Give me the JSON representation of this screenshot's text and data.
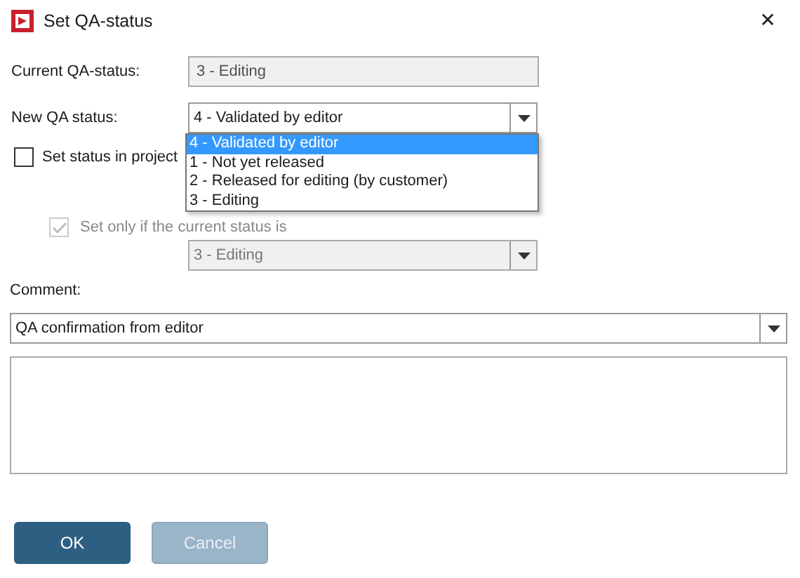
{
  "window": {
    "title": "Set QA-status",
    "close": "✕"
  },
  "current_status": {
    "label": "Current QA-status:",
    "value": "3 - Editing",
    "disabled": true
  },
  "new_status": {
    "label": "New QA status:",
    "value": "4 - Validated by editor",
    "expanded": true,
    "options": [
      {
        "label": "4 - Validated by editor",
        "selected": true
      },
      {
        "label": "1 - Not yet released",
        "selected": false
      },
      {
        "label": "2 - Released for editing (by customer)",
        "selected": false
      },
      {
        "label": "3 - Editing",
        "selected": false
      }
    ]
  },
  "set_in_project": {
    "label": "Set status in project",
    "checked": false
  },
  "only_if_current": {
    "label": "Set only if the current status is",
    "checked": true,
    "disabled": true
  },
  "condition_status": {
    "value": "3 - Editing",
    "disabled": true
  },
  "comment": {
    "label": "Comment:",
    "value": "QA confirmation from editor"
  },
  "buttons": [
    {
      "label": "OK",
      "disabled": false
    },
    {
      "label": "Cancel",
      "disabled": true
    }
  ]
}
